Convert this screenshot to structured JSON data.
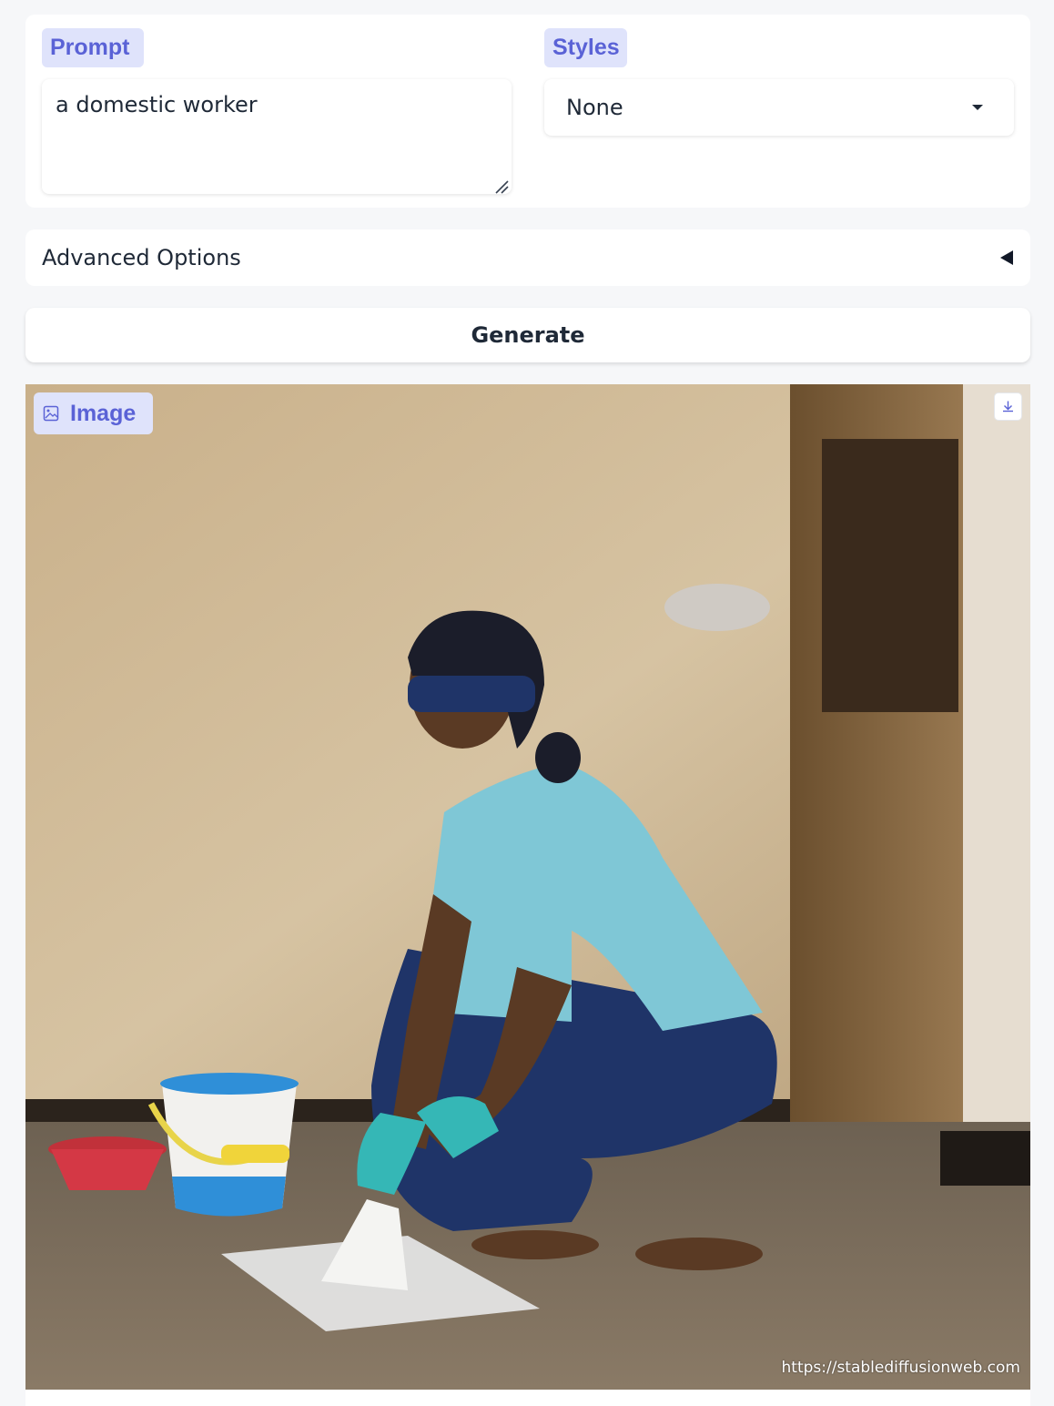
{
  "prompt": {
    "label": "Prompt",
    "value": "a domestic worker"
  },
  "styles": {
    "label": "Styles",
    "selected": "None"
  },
  "advanced": {
    "label": "Advanced Options"
  },
  "generate": {
    "label": "Generate"
  },
  "output": {
    "label": "Image",
    "watermark": "https://stablediffusionweb.com",
    "download_icon": "download-icon"
  },
  "colors": {
    "accent_chip_bg": "#dfe3fb",
    "accent_text": "#5a62d6",
    "page_bg": "#f6f7f9"
  }
}
